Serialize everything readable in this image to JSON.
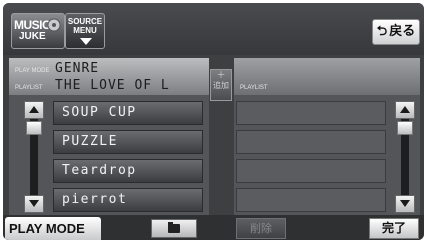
{
  "top_bar": {
    "music_juke": {
      "line1": "MUSIC",
      "line2": "JUKE",
      "icon": "disc-icon"
    },
    "source_menu": {
      "line1": "SOURCE",
      "line2": "MENU",
      "icon": "chevron-down-icon"
    },
    "back": {
      "icon": "return-arrow-icon",
      "label": "戻る"
    }
  },
  "info": {
    "play_mode_label": "PLAY MODE",
    "play_mode_value": "GENRE",
    "playlist_label": "PLAYLIST",
    "playlist_value": "THE LOVE OF L"
  },
  "songs": [
    {
      "title": "SOUP CUP"
    },
    {
      "title": "PUZZLE"
    },
    {
      "title": "Teardrop"
    },
    {
      "title": "pierrot"
    }
  ],
  "add_button": {
    "icon": "plus-icon",
    "label": "追加"
  },
  "playlist_panel": {
    "header_label": "PLAYLIST",
    "slots": [
      "",
      "",
      "",
      ""
    ]
  },
  "bottom_bar": {
    "play_mode_tab": "PLAY MODE",
    "folder_icon": "folder-icon",
    "delete_label": "削除",
    "done_label": "完了"
  },
  "colors": {
    "background": "#3e3f41",
    "panel": "#545558",
    "button_light": "#ffffff",
    "disabled_text": "#85878a"
  }
}
